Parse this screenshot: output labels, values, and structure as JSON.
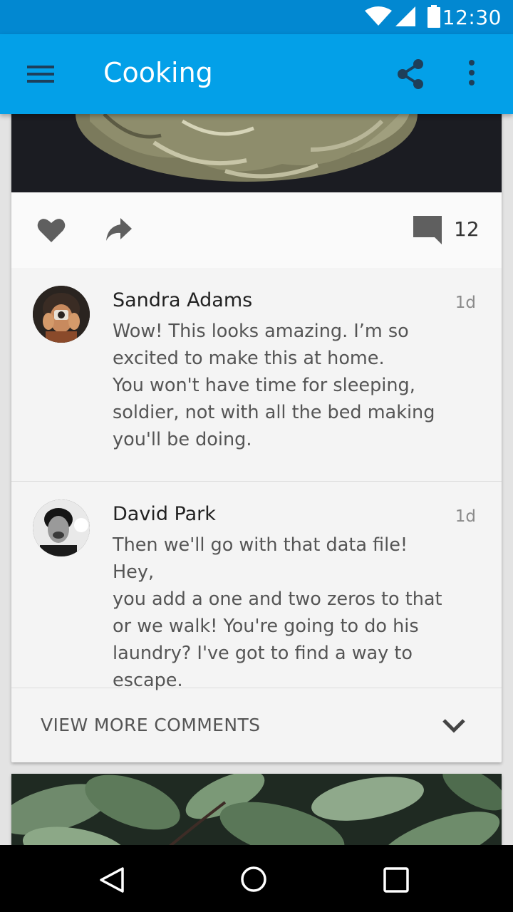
{
  "status_bar": {
    "time": "12:30",
    "icons": [
      "wifi-icon",
      "signal-icon",
      "battery-icon"
    ]
  },
  "app_bar": {
    "title": "Cooking",
    "icons": [
      "menu-icon",
      "share-icon",
      "more-vert-icon"
    ],
    "color": "#03A0E8"
  },
  "post": {
    "image": "artichoke-photo",
    "actions": [
      "heart-icon",
      "forward-icon",
      "comment-icon"
    ],
    "comment_count": "12"
  },
  "comments": [
    {
      "author": "Sandra Adams",
      "time": "1d",
      "lines": [
        "Wow! This looks amazing. I’m so",
        "excited to make this at home.",
        "You won't have time for sleeping,",
        "soldier, not with all the bed making",
        "you'll be doing."
      ]
    },
    {
      "author": "David Park",
      "time": "1d",
      "lines": [
        "Then we'll go with that data file! Hey,",
        "you add a one and two zeros to that",
        "or we walk! You're going to do his",
        "laundry? I've got to find a way to",
        "escape."
      ]
    }
  ],
  "view_more": {
    "label": "VIEW MORE COMMENTS",
    "icon": "chevron-down-icon"
  },
  "next_post": {
    "image": "basil-leaves-photo"
  },
  "nav_bar": {
    "icons": [
      "back-icon",
      "home-icon",
      "recents-icon"
    ]
  }
}
